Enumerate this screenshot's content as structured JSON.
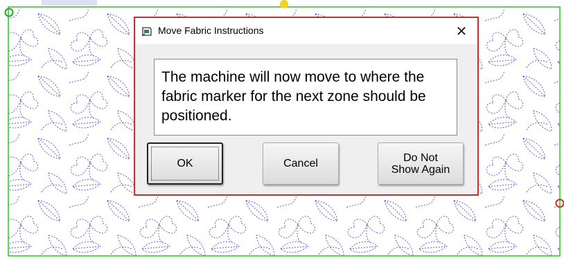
{
  "dialog": {
    "title": "Move Fabric Instructions",
    "close_glyph": "✕",
    "message": "The machine will now move to where the fabric marker for the next zone should be positioned.",
    "buttons": {
      "ok": "OK",
      "cancel": "Cancel",
      "do_not_show_line1": "Do Not",
      "do_not_show_line2": "Show Again"
    },
    "icon": "dialog-app-icon"
  },
  "canvas": {
    "frame_color": "#22cc22",
    "stitch_color": "#4a4ad8",
    "start_marker_color": "#22aa22",
    "end_marker_color": "#d42a2a",
    "needle_marker_color": "#f2d21a"
  }
}
